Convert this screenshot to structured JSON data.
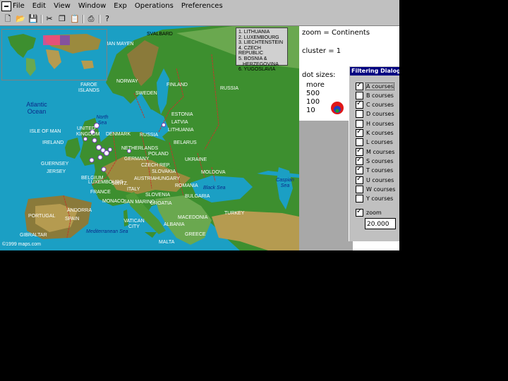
{
  "menu": [
    "File",
    "Edit",
    "View",
    "Window",
    "Exp",
    "Operations",
    "Preferences"
  ],
  "map": {
    "labels": [
      {
        "text": "SVALBARD",
        "cls": "dark"
      },
      {
        "text": "JAN MAYEN",
        "cls": ""
      },
      {
        "text": "FAROE ISLANDS",
        "cls": ""
      },
      {
        "text": "NORWAY",
        "cls": ""
      },
      {
        "text": "SWEDEN",
        "cls": ""
      },
      {
        "text": "FINLAND",
        "cls": ""
      },
      {
        "text": "RUSSIA",
        "cls": ""
      },
      {
        "text": "ESTONIA",
        "cls": ""
      },
      {
        "text": "LATVIA",
        "cls": ""
      },
      {
        "text": "LITHUANIA",
        "cls": ""
      },
      {
        "text": "RUSSIA",
        "cls": ""
      },
      {
        "text": "DENMARK",
        "cls": ""
      },
      {
        "text": "BELARUS",
        "cls": ""
      },
      {
        "text": "NETHERLANDS",
        "cls": ""
      },
      {
        "text": "POLAND",
        "cls": ""
      },
      {
        "text": "UKRAINE",
        "cls": ""
      },
      {
        "text": "GERMANY",
        "cls": ""
      },
      {
        "text": "CZECH REP.",
        "cls": ""
      },
      {
        "text": "MOLDOVA",
        "cls": ""
      },
      {
        "text": "SLOVAKIA",
        "cls": ""
      },
      {
        "text": "HUNGARY",
        "cls": ""
      },
      {
        "text": "AUSTRIA",
        "cls": ""
      },
      {
        "text": "ROMANIA",
        "cls": ""
      },
      {
        "text": "SWITZ.",
        "cls": ""
      },
      {
        "text": "FRANCE",
        "cls": ""
      },
      {
        "text": "ITALY",
        "cls": ""
      },
      {
        "text": "BULGARIA",
        "cls": ""
      },
      {
        "text": "MONACO",
        "cls": ""
      },
      {
        "text": "SAN MARINO",
        "cls": ""
      },
      {
        "text": "ANDORRA",
        "cls": ""
      },
      {
        "text": "PORTUGAL",
        "cls": ""
      },
      {
        "text": "SPAIN",
        "cls": ""
      },
      {
        "text": "VATICAN CITY",
        "cls": ""
      },
      {
        "text": "MACEDONIA",
        "cls": ""
      },
      {
        "text": "ALBANIA",
        "cls": ""
      },
      {
        "text": "GREECE",
        "cls": ""
      },
      {
        "text": "TURKEY",
        "cls": ""
      },
      {
        "text": "GIBRALTAR",
        "cls": ""
      },
      {
        "text": "MALTA",
        "cls": ""
      },
      {
        "text": "IRELAND",
        "cls": ""
      },
      {
        "text": "ISLE OF MAN",
        "cls": ""
      },
      {
        "text": "GUERNSEY",
        "cls": ""
      },
      {
        "text": "JERSEY",
        "cls": ""
      },
      {
        "text": "UNITED KINGDOM",
        "cls": ""
      },
      {
        "text": "LUXEMBOURG",
        "cls": ""
      },
      {
        "text": "BELGIUM",
        "cls": ""
      },
      {
        "text": "SLOVENIA",
        "cls": ""
      },
      {
        "text": "CROATIA",
        "cls": ""
      },
      {
        "text": "North Sea",
        "cls": "sea"
      },
      {
        "text": "Black Sea",
        "cls": "sea"
      },
      {
        "text": "Caspian Sea",
        "cls": "sea"
      },
      {
        "text": "Mediterranean Sea",
        "cls": "sea"
      },
      {
        "text": "Atlantic Ocean",
        "cls": "ocean"
      }
    ],
    "legend": [
      "1. LITHUANIA",
      "2. LUXEMBOURG",
      "3. LIECHTENSTEIN",
      "4. CZECH REPUBLIC",
      "5. BOSNIA &",
      "HERZEGOVINA",
      "6. YUGOSLAVIA"
    ],
    "copyright": "©1999 maps.com"
  },
  "info": {
    "zoom": "zoom = Continents",
    "cluster": "cluster = 1",
    "dot_title": "dot sizes:",
    "dot_sizes": [
      "more",
      "500",
      "100",
      "10"
    ]
  },
  "dialog": {
    "title": "Filtering Dialog",
    "options": [
      {
        "label": "A courses",
        "checked": true
      },
      {
        "label": "B courses",
        "checked": false
      },
      {
        "label": "C courses",
        "checked": true
      },
      {
        "label": "D courses",
        "checked": false
      },
      {
        "label": "H courses",
        "checked": false
      },
      {
        "label": "K courses",
        "checked": true
      },
      {
        "label": "L courses",
        "checked": false
      },
      {
        "label": "M courses",
        "checked": true
      },
      {
        "label": "S courses",
        "checked": true
      },
      {
        "label": "T courses",
        "checked": true
      },
      {
        "label": "U courses",
        "checked": true
      },
      {
        "label": "W courses",
        "checked": false
      },
      {
        "label": "Y courses",
        "checked": false
      }
    ],
    "zoom_option": {
      "label": "zoom",
      "checked": true
    },
    "zoom_value": "20.000"
  },
  "colors": {
    "sea": "#1b9fc4",
    "land": "#3d8f2f",
    "title_bar": "#000080"
  }
}
